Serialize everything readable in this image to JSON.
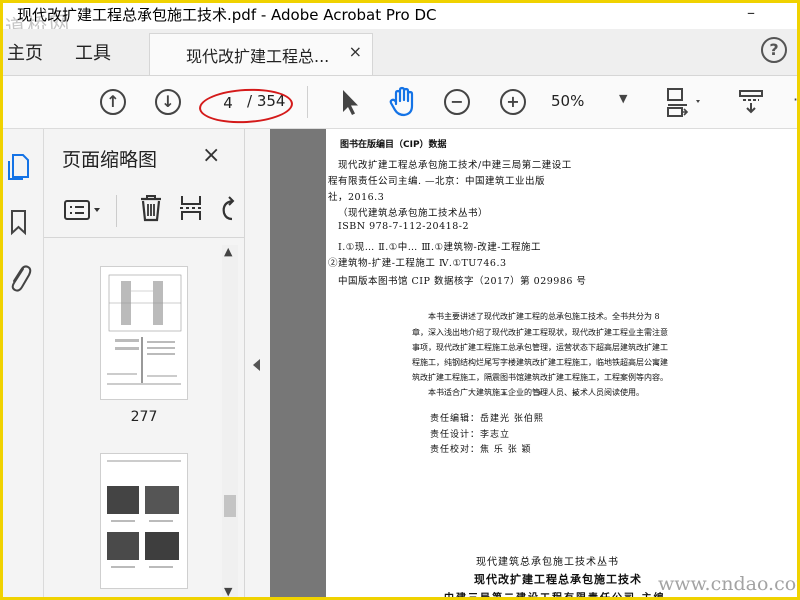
{
  "window": {
    "title": "现代改扩建工程总承包施工技术.pdf - Adobe Acrobat Pro DC",
    "watermark_top": "道桥网",
    "watermark_bottom": "www.cndao.com"
  },
  "tabs": {
    "home": "主页",
    "tools": "工具",
    "document": "现代改扩建工程总...",
    "close_symbol": "×",
    "help_symbol": "?"
  },
  "toolbar": {
    "current_page": "4",
    "total_pages": "/ 354",
    "zoom": "50%",
    "zoom_caret": "▼"
  },
  "panel": {
    "title": "页面缩略图",
    "close_symbol": "×",
    "thumbnails": [
      {
        "label": "277"
      },
      {
        "label": ""
      }
    ]
  },
  "document_page": {
    "cip_heading": "图书在版编目（CIP）数据",
    "cip_lines": [
      "现代改扩建工程总承包施工技术/中建三局第二建设工",
      "程有限责任公司主编. —北京：中国建筑工业出版",
      "社，2016.3",
      "（现代建筑总承包施工技术丛书）",
      "ISBN 978-7-112-20418-2",
      "Ⅰ.①现…  Ⅱ.①中…  Ⅲ.①建筑物-改建-工程施工",
      "②建筑物-扩建-工程施工  Ⅳ.①TU746.3",
      "中国版本图书馆 CIP 数据核字（2017）第 029986 号"
    ],
    "intro_lines": [
      "本书主要讲述了现代改扩建工程的总承包施工技术。全书共分为 8",
      "章，深入浅出地介绍了现代改扩建工程现状，现代改扩建工程业主需注意",
      "事项，现代改扩建工程施工总承包管理，运营状态下超高层建筑改扩建工",
      "程施工，纯钢结构烂尾写字楼建筑改扩建工程施工，临地铁超高层公寓建",
      "筑改扩建工程施工，隔震图书馆建筑改扩建工程施工，工程案例等内容。",
      "本书适合广大建筑施工企业的管理人员、技术人员阅读使用。"
    ],
    "stars": "* * *",
    "staff": [
      "责任编辑：岳建光  张伯熙",
      "责任设计：李志立",
      "责任校对：焦  乐  张  颖"
    ],
    "series_title": "现代建筑总承包施工技术丛书",
    "book_title": "现代改扩建工程总承包施工技术",
    "author_line": "中建三局第二建设工程有限责任公司  主编"
  },
  "colors": {
    "frame_border": "#f0d200",
    "annotation_ellipse": "#d41a1a",
    "hand_tool_active": "#1473e6",
    "doc_background": "#777777"
  },
  "icons": {
    "tab_close": "close-icon",
    "help": "help-icon",
    "prev_page": "arrow-up-circle-icon",
    "next_page": "arrow-down-circle-icon",
    "select_tool": "cursor-arrow-icon",
    "hand_tool": "hand-icon",
    "zoom_out": "minus-circle-icon",
    "zoom_in": "plus-circle-icon"
  }
}
